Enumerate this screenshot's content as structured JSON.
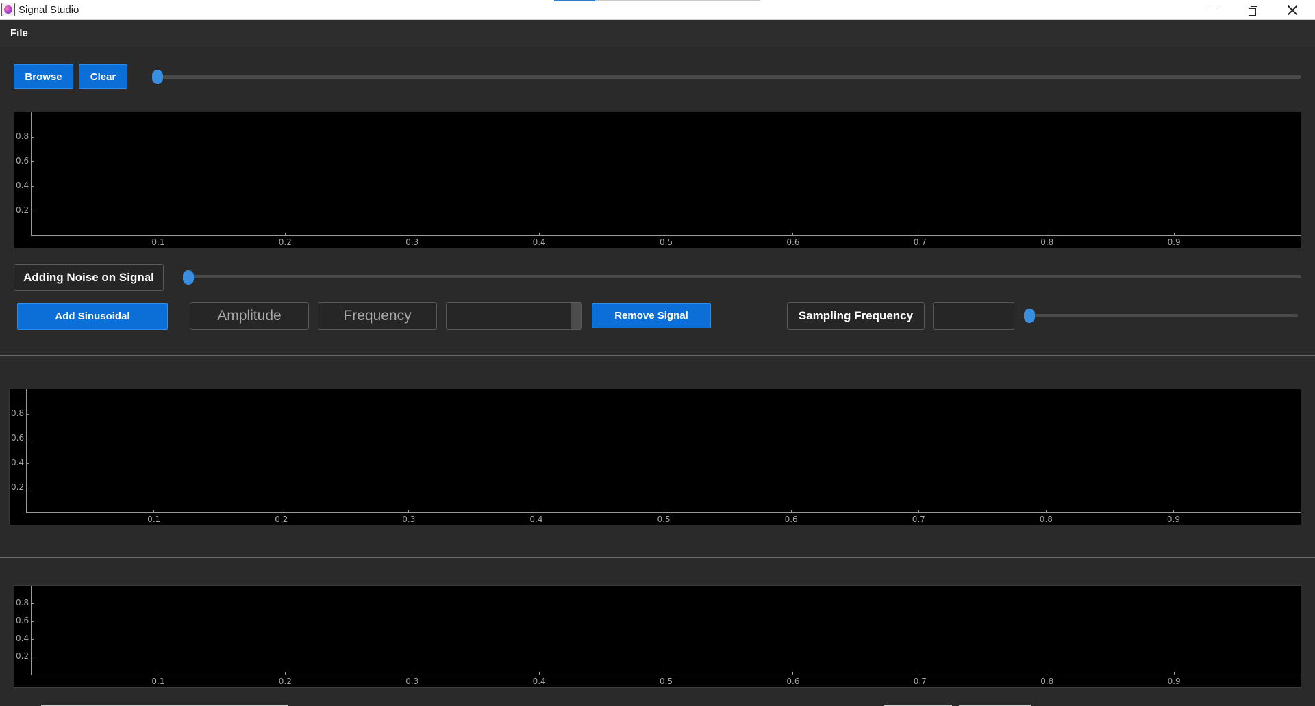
{
  "window": {
    "title": "Signal Studio"
  },
  "menu": {
    "file": "File"
  },
  "toolbar": {
    "browse": "Browse",
    "clear": "Clear",
    "signal_slider_value": 0
  },
  "noise": {
    "label": "Adding Noise on Signal",
    "slider_value": 0
  },
  "composer": {
    "add_sinusoidal": "Add Sinusoidal",
    "amplitude_placeholder": "Amplitude",
    "frequency_placeholder": "Frequency",
    "signal_select_value": "",
    "remove_signal": "Remove Signal",
    "sampling_label": "Sampling Frequency",
    "sampling_value": "",
    "sampling_slider_value": 0
  },
  "plots": [
    {
      "id": "original",
      "x_ticks": [
        "0.1",
        "0.2",
        "0.3",
        "0.4",
        "0.5",
        "0.6",
        "0.7",
        "0.8",
        "0.9"
      ],
      "y_ticks": [
        "0.8",
        "0.6",
        "0.4",
        "0.2"
      ]
    },
    {
      "id": "reconstructed",
      "x_ticks": [
        "0.1",
        "0.2",
        "0.3",
        "0.4",
        "0.5",
        "0.6",
        "0.7",
        "0.8",
        "0.9"
      ],
      "y_ticks": [
        "0.8",
        "0.6",
        "0.4",
        "0.2"
      ]
    },
    {
      "id": "difference",
      "x_ticks": [
        "0.1",
        "0.2",
        "0.3",
        "0.4",
        "0.5",
        "0.6",
        "0.7",
        "0.8",
        "0.9"
      ],
      "y_ticks": [
        "0.8",
        "0.6",
        "0.4",
        "0.2"
      ]
    }
  ],
  "icons": {
    "app": "signal-studio-logo-icon",
    "minimize": "minimize-icon",
    "maximize": "restore-icon",
    "close": "close-icon"
  },
  "colors": {
    "accent": "#0c6fd8",
    "slider_handle": "#3a8ee0",
    "background": "#2a2a2a",
    "plot_bg": "#000000"
  }
}
